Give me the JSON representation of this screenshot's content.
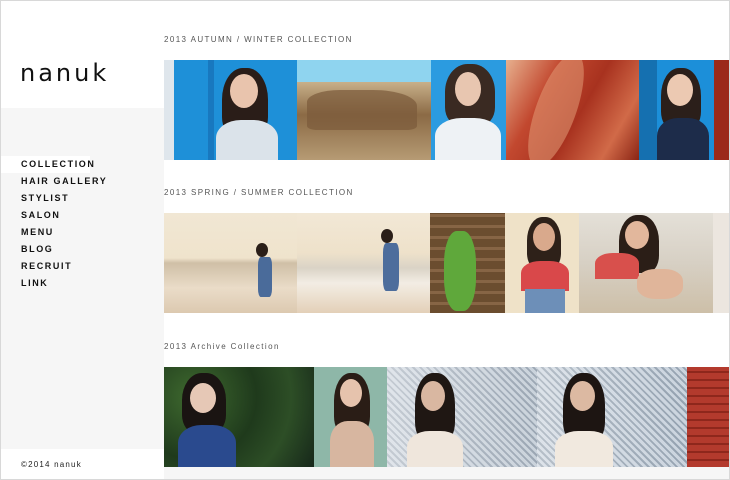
{
  "brand": {
    "logo": "nanuk"
  },
  "nav": {
    "items": [
      {
        "label": "COLLECTION",
        "active": true
      },
      {
        "label": "HAIR GALLERY",
        "active": false
      },
      {
        "label": "STYLIST",
        "active": false
      },
      {
        "label": "SALON",
        "active": false
      },
      {
        "label": "MENU",
        "active": false
      },
      {
        "label": "BLOG",
        "active": false
      },
      {
        "label": "RECRUIT",
        "active": false
      },
      {
        "label": "LINK",
        "active": false
      }
    ]
  },
  "footer": {
    "copyright": "©2014  nanuk"
  },
  "sections": [
    {
      "title": "2013 AUTUMN / WINTER COLLECTION"
    },
    {
      "title": "2013 SPRING / SUMMER COLLECTION"
    },
    {
      "title": "2013 Archive Collection"
    }
  ],
  "colors": {
    "sidebar_bg": "#f6f6f6",
    "accent_blue": "#1f8fd6",
    "canyon_red": "#b8412c"
  }
}
